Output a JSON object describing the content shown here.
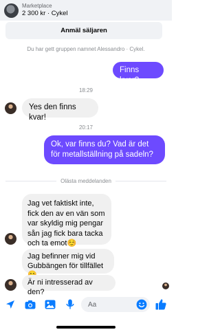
{
  "header": {
    "subtitle": "Marketplace",
    "title": "2 300 kr · Cykel",
    "report_label": "Anmäl säljaren"
  },
  "conversation": {
    "system_note": "Du har gett gruppen namnet Alessandro · Cykel.",
    "messages": [
      {
        "direction": "out",
        "text": "Finns kvar?"
      },
      {
        "type": "time",
        "text": "18:29"
      },
      {
        "direction": "in",
        "text": "Yes den finns kvar!"
      },
      {
        "type": "time",
        "text": "20:17"
      },
      {
        "direction": "out",
        "text": "Ok, var finns du? Vad är det för metallställning på sadeln?"
      },
      {
        "type": "divider",
        "text": "Olästa meddelanden"
      },
      {
        "direction": "in",
        "text": "Jag vet faktiskt inte, fick den av en vän som var skyldig mig pengar sån jag fick bara tacka och ta emot☺️"
      },
      {
        "direction": "in",
        "text": "Jag befinner mig vid Gubbängen för tillfället 😊"
      },
      {
        "direction": "in",
        "text": "Är ni intresserad av den?"
      }
    ]
  },
  "composer": {
    "placeholder": "Aa"
  },
  "colors": {
    "outgoing_bubble": "#6d4aff",
    "incoming_bubble": "#f0f0f0",
    "accent_icon": "#0a7cff"
  },
  "icons": [
    "location-arrow-icon",
    "camera-icon",
    "gallery-icon",
    "microphone-icon",
    "emoji-icon",
    "thumbs-up-icon"
  ]
}
